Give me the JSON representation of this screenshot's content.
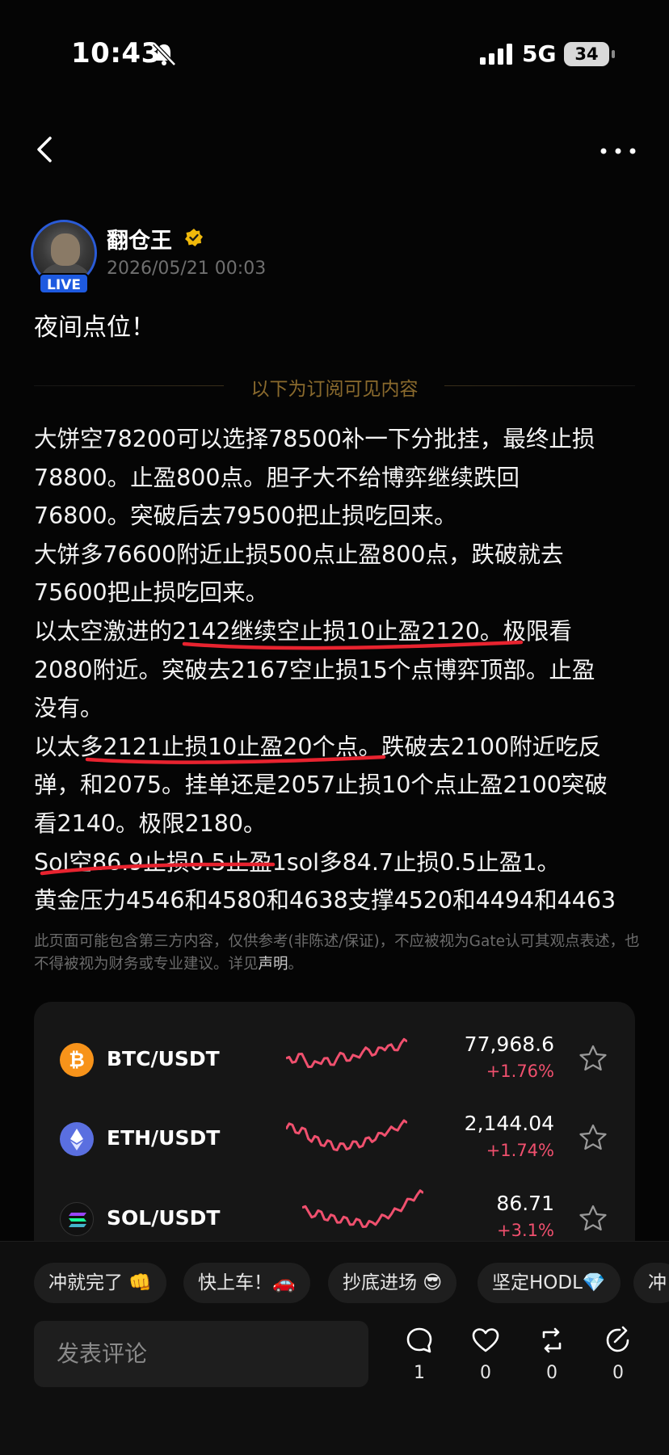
{
  "status": {
    "time": "10:43",
    "network": "5G",
    "battery": "34"
  },
  "author": {
    "name": "翻仓王",
    "live_badge": "LIVE",
    "timestamp": "2026/05/21 00:03"
  },
  "post": {
    "title": "夜间点位！",
    "divider_label": "以下为订阅可见内容",
    "body_lines": [
      "大饼空78200可以选择78500补一下分批挂，最终止损",
      "78800。止盈800点。胆子大不给博弈继续跌回",
      "76800。突破后去79500把止损吃回来。",
      "大饼多76600附近止损500点止盈800点，跌破就去",
      "75600把止损吃回来。",
      "以太空激进的2142继续空止损10止盈2120。极限看",
      "2080附近。突破去2167空止损15个点博弈顶部。止盈",
      "没有。",
      "以太多2121止损10止盈20个点。跌破去2100附近吃反",
      "弹，和2075。挂单还是2057止损10个点止盈2100突破",
      "看2140。极限2180。",
      "Sol空86.9止损0.5止盈1sol多84.7止损0.5止盈1。",
      "黄金压力4546和4580和4638支撑4520和4494和4463"
    ],
    "disclaimer_text": "此页面可能包含第三方内容，仅供参考(非陈述/保证)，不应被视为Gate认可其观点表述，也不得被视为财务或专业建议。详见",
    "disclaimer_link": "声明",
    "disclaimer_end": "。"
  },
  "markets": [
    {
      "pair": "BTC/USDT",
      "price": "77,968.6",
      "change": "+1.76%",
      "icon": "bitcoin-icon",
      "color": "#f7931a",
      "trend": [
        0.5,
        0.6,
        0.4,
        0.55,
        0.7,
        0.6,
        0.5,
        0.65,
        0.5,
        0.4,
        0.55,
        0.45,
        0.35,
        0.3,
        0.4,
        0.25,
        0.2,
        0.3,
        0.15,
        0.1
      ]
    },
    {
      "pair": "ETH/USDT",
      "price": "2,144.04",
      "change": "+1.74%",
      "icon": "ethereum-icon",
      "color": "#627eea",
      "trend": [
        0.3,
        0.2,
        0.4,
        0.3,
        0.6,
        0.5,
        0.7,
        0.6,
        0.8,
        0.65,
        0.75,
        0.6,
        0.7,
        0.5,
        0.55,
        0.4,
        0.35,
        0.3,
        0.2,
        0.15
      ]
    },
    {
      "pair": "SOL/USDT",
      "price": "86.71",
      "change": "+3.1%",
      "icon": "solana-icon",
      "color": "#14f195",
      "trend": [
        0.4,
        0.5,
        0.6,
        0.5,
        0.7,
        0.6,
        0.75,
        0.65,
        0.8,
        0.7,
        0.85,
        0.75,
        0.7,
        0.6,
        0.55,
        0.45,
        0.35,
        0.2,
        0.1,
        0.05
      ]
    }
  ],
  "quick_replies": [
    "冲就完了 👊",
    "快上车！🚗",
    "抄底进场 😎",
    "坚定HODL💎",
    "冲"
  ],
  "comment_placeholder": "发表评论",
  "actions": [
    {
      "name": "comment",
      "count": "1"
    },
    {
      "name": "like",
      "count": "0"
    },
    {
      "name": "repost",
      "count": "0"
    },
    {
      "name": "share",
      "count": "0"
    }
  ]
}
